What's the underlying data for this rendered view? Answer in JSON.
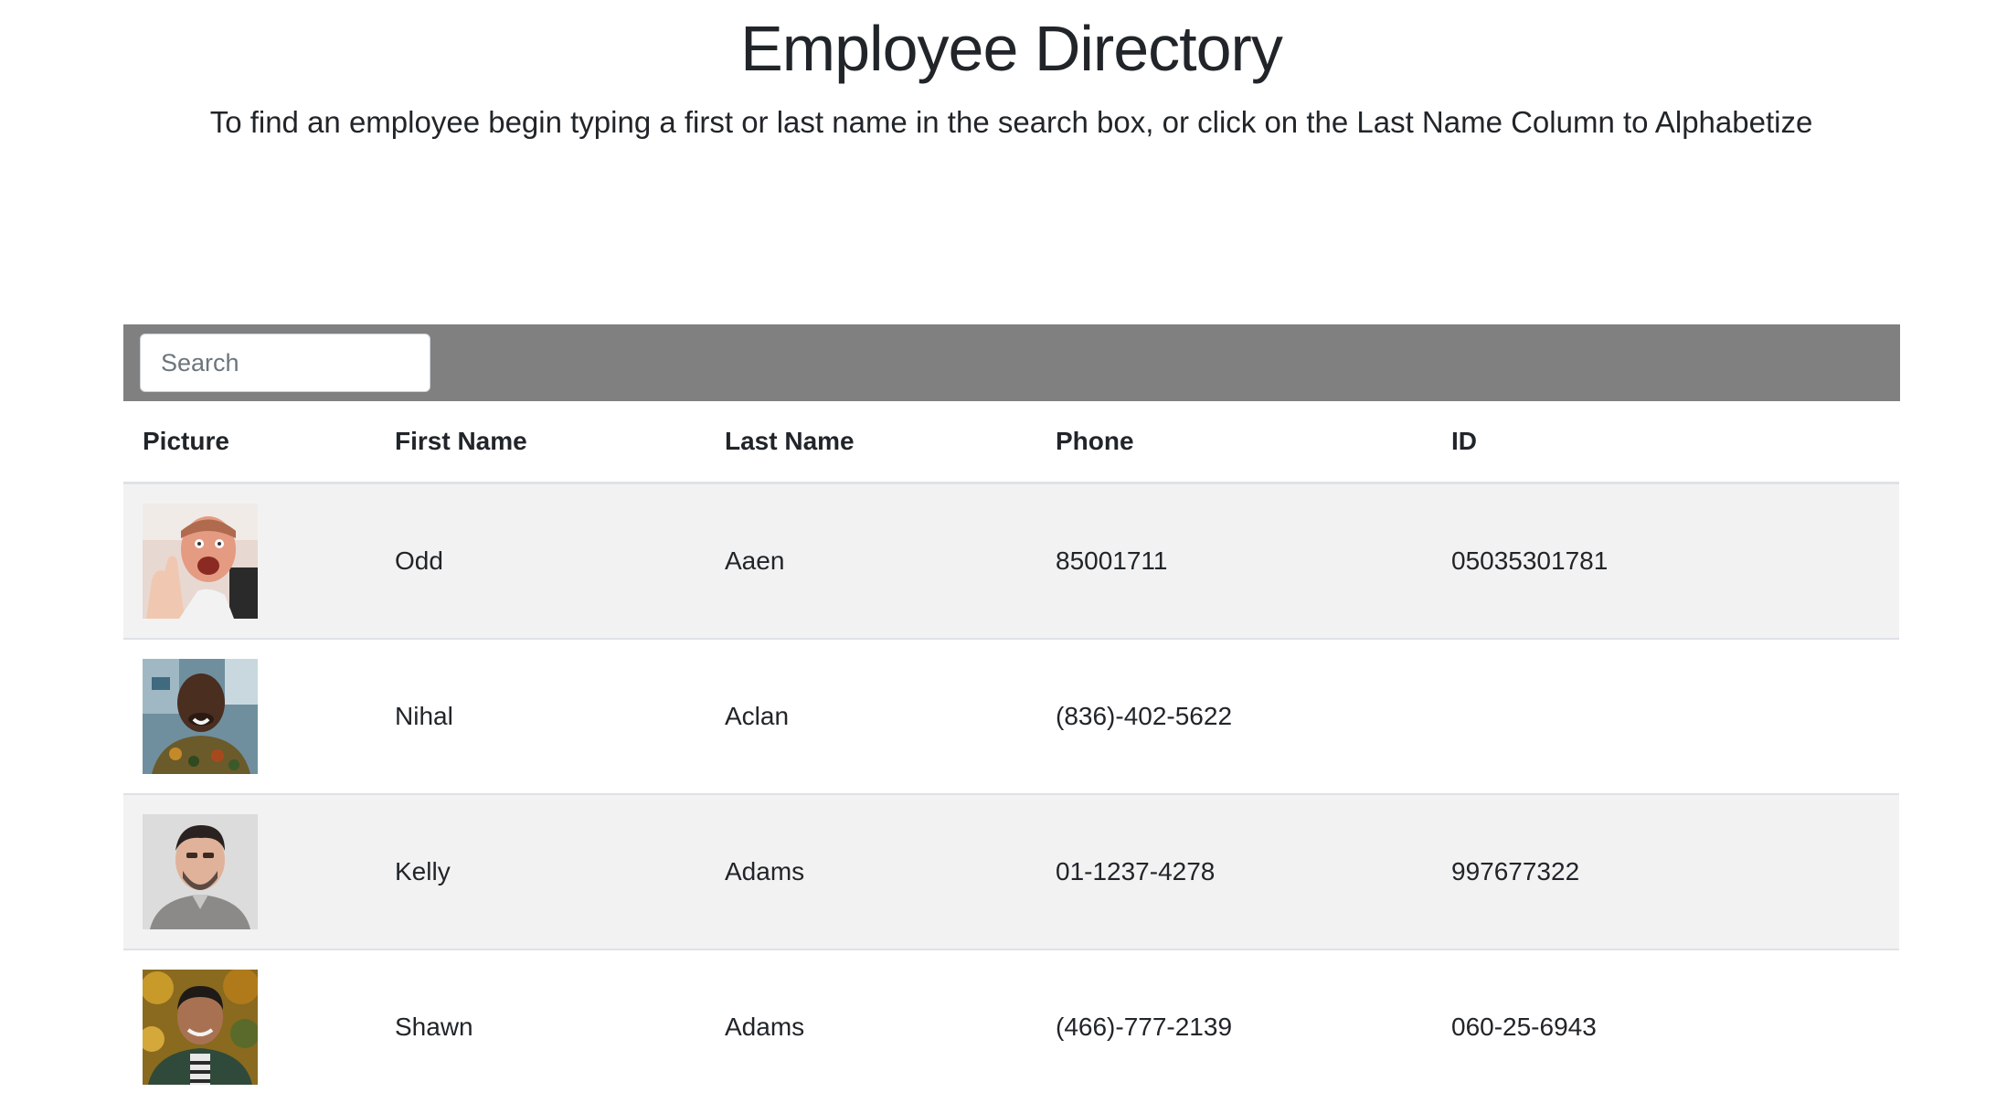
{
  "header": {
    "title": "Employee Directory",
    "subtitle": "To find an employee begin typing a first or last name in the search box, or click on the Last Name Column to Alphabetize"
  },
  "search": {
    "placeholder": "Search",
    "value": ""
  },
  "table": {
    "columns": [
      "Picture",
      "First Name",
      "Last Name",
      "Phone",
      "ID"
    ],
    "rows": [
      {
        "first": "Odd",
        "last": "Aaen",
        "phone": "85001711",
        "id": "05035301781",
        "picture": "employee-photo-odd-aaen"
      },
      {
        "first": "Nihal",
        "last": "Aclan",
        "phone": "(836)-402-5622",
        "id": "",
        "picture": "employee-photo-nihal-aclan"
      },
      {
        "first": "Kelly",
        "last": "Adams",
        "phone": "01-1237-4278",
        "id": "997677322",
        "picture": "employee-photo-kelly-adams"
      },
      {
        "first": "Shawn",
        "last": "Adams",
        "phone": "(466)-777-2139",
        "id": "060-25-6943",
        "picture": "employee-photo-shawn-adams"
      }
    ]
  },
  "colors": {
    "toolbar_bg": "#808080",
    "stripe_bg": "#f2f2f2",
    "border": "#dee2e6",
    "text": "#212529"
  }
}
